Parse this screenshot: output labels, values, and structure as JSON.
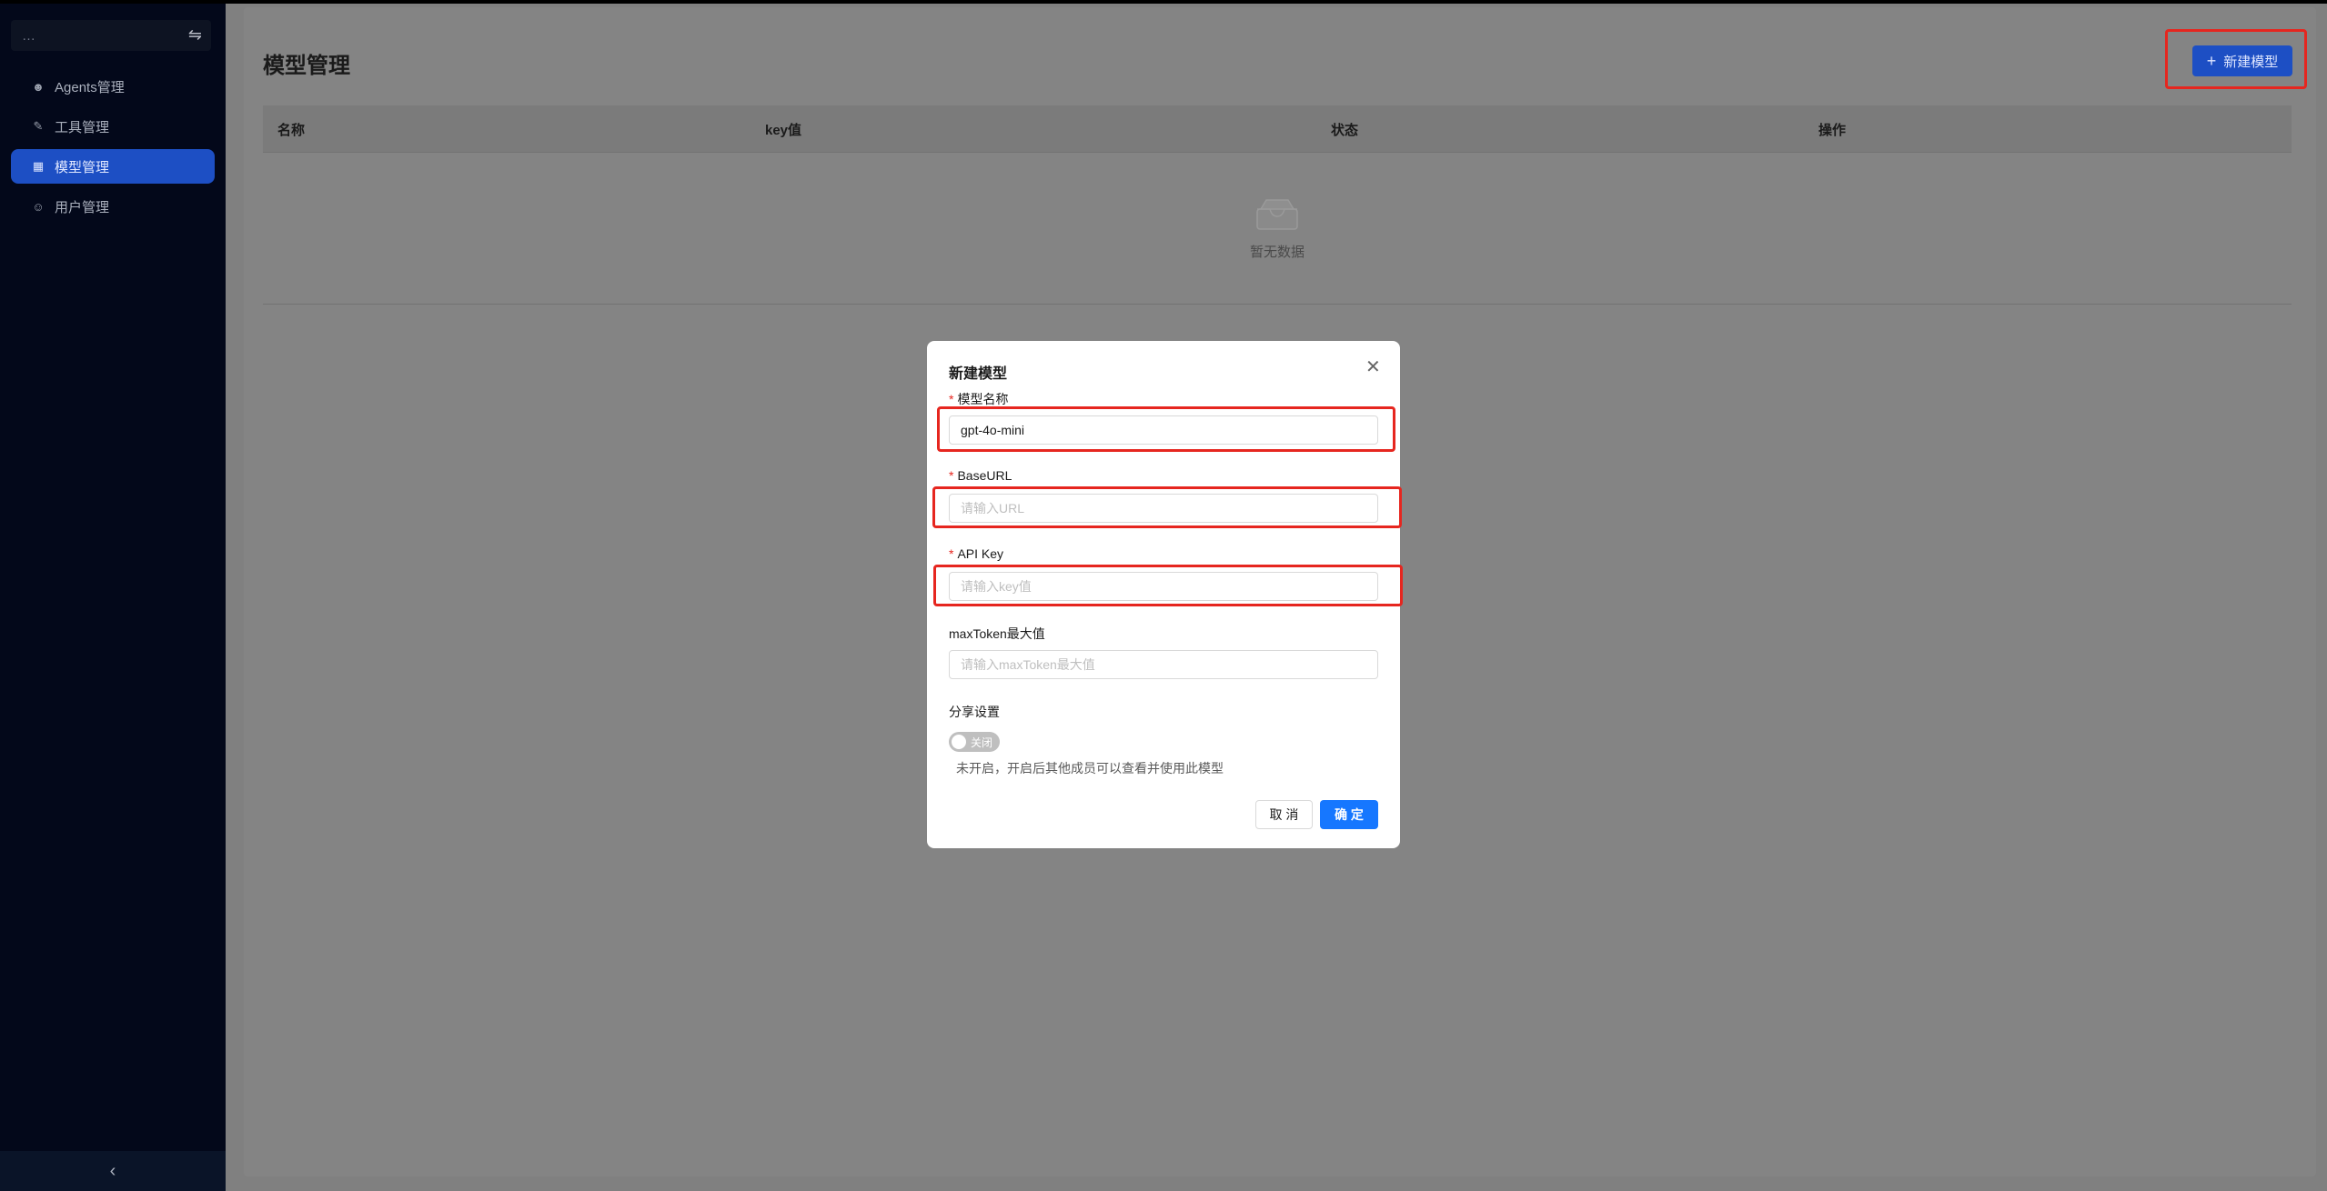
{
  "sidebar": {
    "header_title": "…",
    "swap_icon": "⇋",
    "items": [
      {
        "label": "Agents管理",
        "icon": "agents-icon",
        "active": false
      },
      {
        "label": "工具管理",
        "icon": "tool-icon",
        "active": false
      },
      {
        "label": "模型管理",
        "icon": "model-icon",
        "active": true
      },
      {
        "label": "用户管理",
        "icon": "user-icon",
        "active": false
      }
    ],
    "collapse_icon": "‹"
  },
  "main": {
    "title": "模型管理",
    "new_button": "新建模型",
    "table": {
      "columns": [
        "名称",
        "key值",
        "状态",
        "操作"
      ],
      "empty_text": "暂无数据"
    }
  },
  "modal": {
    "title": "新建模型",
    "fields": {
      "model_name": {
        "label": "模型名称",
        "value": "gpt-4o-mini",
        "required": true
      },
      "base_url": {
        "label": "BaseURL",
        "placeholder": "请输入URL",
        "required": true
      },
      "api_key": {
        "label": "API Key",
        "placeholder": "请输入key值",
        "required": true
      },
      "max_token": {
        "label": "maxToken最大值",
        "placeholder": "请输入maxToken最大值",
        "required": false
      }
    },
    "share": {
      "label": "分享设置",
      "toggle_text": "关闭",
      "hint": "未开启，开启后其他成员可以查看并使用此模型"
    },
    "cancel": "取 消",
    "ok": "确 定"
  },
  "colors": {
    "sidebar_bg": "#03081a",
    "accent": "#1d4fc4",
    "primary_button": "#1677ff",
    "highlight": "#e6261f"
  }
}
